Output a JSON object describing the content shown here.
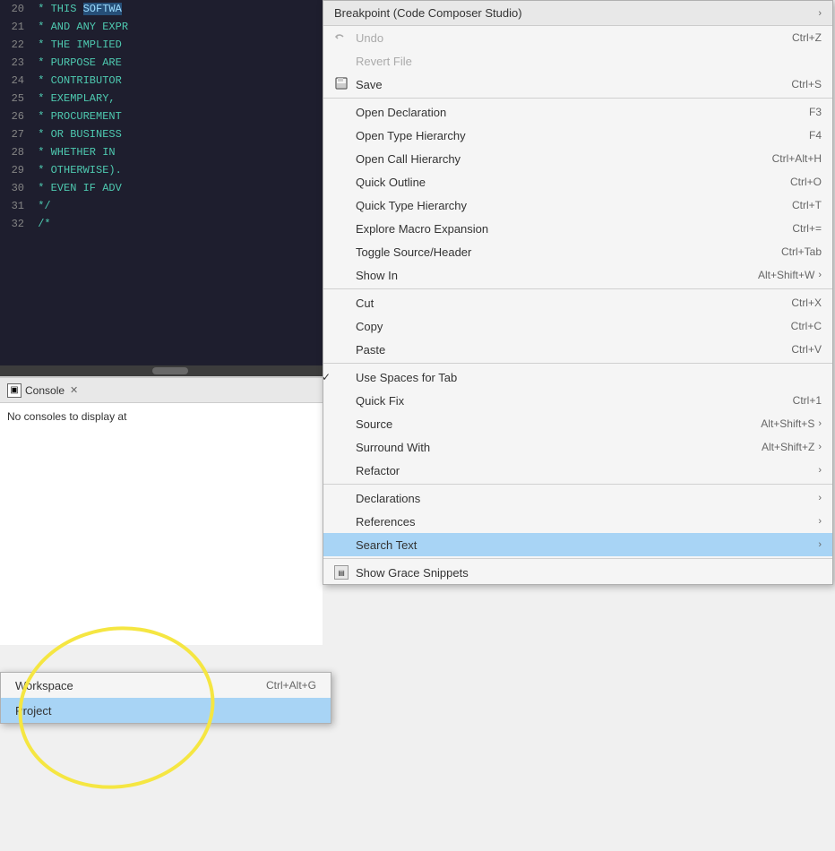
{
  "editor": {
    "lines": [
      {
        "num": "20",
        "content": " * THIS SOFTWA",
        "highlight": "SOFTWA"
      },
      {
        "num": "21",
        "content": " * AND ANY EXPR"
      },
      {
        "num": "22",
        "content": " * THE IMPLIED"
      },
      {
        "num": "23",
        "content": " * PURPOSE ARE"
      },
      {
        "num": "24",
        "content": " * CONTRIBUTOR"
      },
      {
        "num": "25",
        "content": " * EXEMPLARY,"
      },
      {
        "num": "26",
        "content": " * PROCUREMENT"
      },
      {
        "num": "27",
        "content": " * OR BUSINESS"
      },
      {
        "num": "28",
        "content": " * WHETHER IN"
      },
      {
        "num": "29",
        "content": " * OTHERWISE)."
      },
      {
        "num": "30",
        "content": " * EVEN IF ADV"
      },
      {
        "num": "31",
        "content": " */"
      },
      {
        "num": "32",
        "content": " /*"
      }
    ]
  },
  "console": {
    "title": "Console",
    "close_label": "✕",
    "no_console_text": "No consoles to display at"
  },
  "context_menu": {
    "top_item": {
      "label": "Breakpoint (Code Composer Studio)",
      "arrow": "›"
    },
    "items": [
      {
        "id": "undo",
        "label": "Undo",
        "shortcut": "Ctrl+Z",
        "disabled": true,
        "has_icon": true
      },
      {
        "id": "revert",
        "label": "Revert File",
        "disabled": true
      },
      {
        "id": "save",
        "label": "Save",
        "shortcut": "Ctrl+S",
        "has_icon": true
      },
      {
        "id": "separator1"
      },
      {
        "id": "open-declaration",
        "label": "Open Declaration",
        "shortcut": "F3"
      },
      {
        "id": "open-type-hierarchy",
        "label": "Open Type Hierarchy",
        "shortcut": "F4"
      },
      {
        "id": "open-call-hierarchy",
        "label": "Open Call Hierarchy",
        "shortcut": "Ctrl+Alt+H"
      },
      {
        "id": "quick-outline",
        "label": "Quick Outline",
        "shortcut": "Ctrl+O"
      },
      {
        "id": "quick-type-hierarchy",
        "label": "Quick Type Hierarchy",
        "shortcut": "Ctrl+T"
      },
      {
        "id": "explore-macro",
        "label": "Explore Macro Expansion",
        "shortcut": "Ctrl+="
      },
      {
        "id": "toggle-source",
        "label": "Toggle Source/Header",
        "shortcut": "Ctrl+Tab"
      },
      {
        "id": "show-in",
        "label": "Show In",
        "shortcut": "Alt+Shift+W",
        "arrow": "›"
      },
      {
        "id": "separator2"
      },
      {
        "id": "cut",
        "label": "Cut",
        "shortcut": "Ctrl+X"
      },
      {
        "id": "copy",
        "label": "Copy",
        "shortcut": "Ctrl+C"
      },
      {
        "id": "paste",
        "label": "Paste",
        "shortcut": "Ctrl+V"
      },
      {
        "id": "separator3"
      },
      {
        "id": "use-spaces",
        "label": "Use Spaces for Tab",
        "checked": true
      },
      {
        "id": "quick-fix",
        "label": "Quick Fix",
        "shortcut": "Ctrl+1"
      },
      {
        "id": "source",
        "label": "Source",
        "shortcut": "Alt+Shift+S",
        "arrow": "›"
      },
      {
        "id": "surround-with",
        "label": "Surround With",
        "shortcut": "Alt+Shift+Z",
        "arrow": "›"
      },
      {
        "id": "refactor",
        "label": "Refactor",
        "arrow": "›"
      },
      {
        "id": "separator4"
      },
      {
        "id": "declarations",
        "label": "Declarations",
        "arrow": "›"
      },
      {
        "id": "references",
        "label": "References",
        "arrow": "›"
      },
      {
        "id": "search-text",
        "label": "Search Text",
        "arrow": "›",
        "highlighted": true
      },
      {
        "id": "separator5"
      },
      {
        "id": "show-grace",
        "label": "Show Grace Snippets",
        "has_grace_icon": true
      }
    ]
  },
  "submenu": {
    "items": [
      {
        "id": "workspace",
        "label": "Workspace",
        "shortcut": "Ctrl+Alt+G"
      },
      {
        "id": "project",
        "label": "Project",
        "shortcut": "",
        "active": true
      }
    ]
  }
}
